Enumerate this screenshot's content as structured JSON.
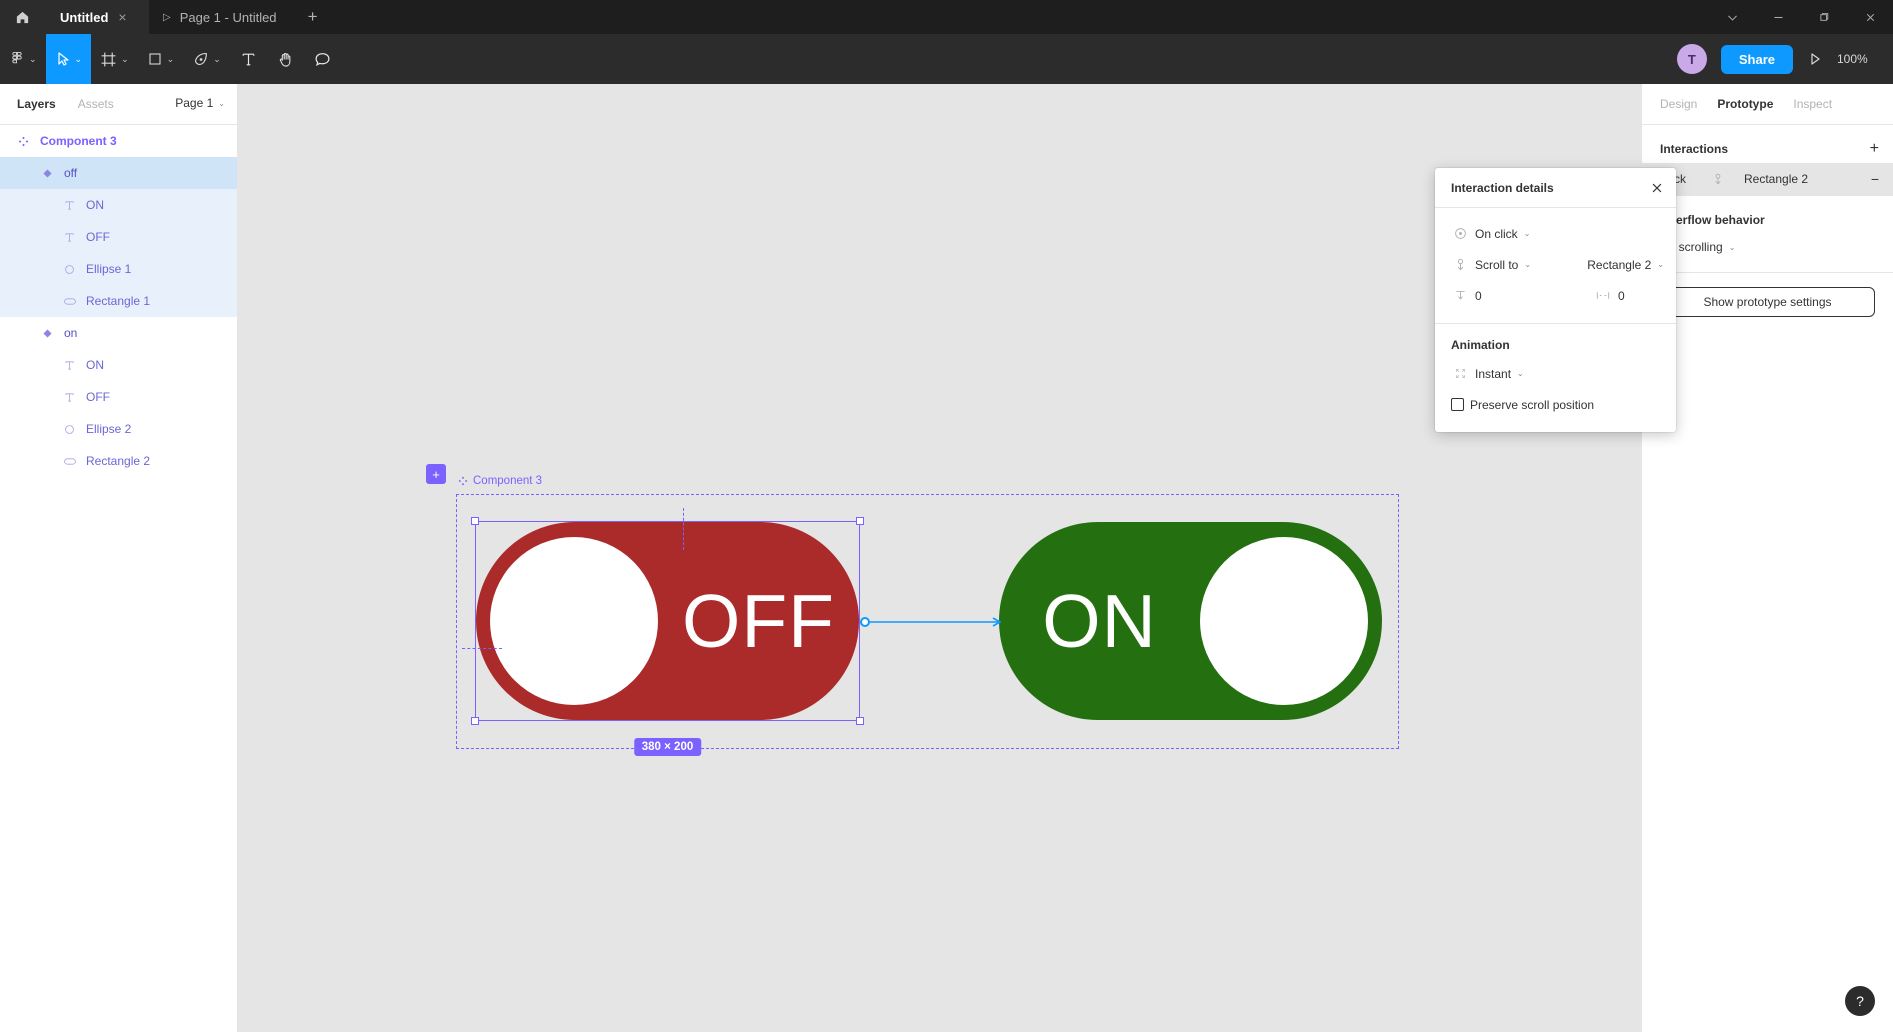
{
  "titlebar": {
    "home_icon": "home-icon",
    "file_tab": {
      "label": "Untitled",
      "close": "×"
    },
    "page_tab": {
      "play": "▷",
      "label": "Page 1 - Untitled"
    },
    "new_tab": "+",
    "window": {
      "chevron": "⌄",
      "minimize": "—",
      "maximize": "❐",
      "close": "✕"
    }
  },
  "toolbar": {
    "items": [
      {
        "name": "figma-menu-icon",
        "caret": "⌄"
      },
      {
        "name": "move-tool-icon",
        "caret": "⌄"
      },
      {
        "name": "frame-tool-icon",
        "caret": "⌄"
      },
      {
        "name": "shape-tool-icon",
        "caret": "⌄"
      },
      {
        "name": "pen-tool-icon",
        "caret": "⌄"
      },
      {
        "name": "text-tool-icon",
        "caret": ""
      },
      {
        "name": "hand-tool-icon",
        "caret": ""
      },
      {
        "name": "comment-tool-icon",
        "caret": ""
      }
    ],
    "avatar_initial": "T",
    "share_label": "Share",
    "present_icon": "▷",
    "zoom_level": "100%",
    "accent_color": "#0d99ff"
  },
  "left_panel": {
    "tabs": [
      {
        "label": "Layers",
        "active": true
      },
      {
        "label": "Assets",
        "active": false
      }
    ],
    "page_selector": {
      "label": "Page 1",
      "caret": "⌄"
    },
    "layers": [
      {
        "label": "Component 3",
        "icon": "component-icon",
        "level": "comp",
        "state": "none"
      },
      {
        "label": "off",
        "icon": "variant-icon",
        "level": "variant",
        "state": "sel-strong"
      },
      {
        "label": "ON",
        "icon": "text-icon",
        "level": "child",
        "state": "sel-light"
      },
      {
        "label": "OFF",
        "icon": "text-icon",
        "level": "child",
        "state": "sel-light"
      },
      {
        "label": "Ellipse 1",
        "icon": "ellipse-icon",
        "level": "child",
        "state": "sel-light"
      },
      {
        "label": "Rectangle 1",
        "icon": "rectangle-icon",
        "level": "child",
        "state": "sel-light"
      },
      {
        "label": "on",
        "icon": "variant-icon",
        "level": "variant",
        "state": "none"
      },
      {
        "label": "ON",
        "icon": "text-icon",
        "level": "child",
        "state": "none"
      },
      {
        "label": "OFF",
        "icon": "text-icon",
        "level": "child",
        "state": "none"
      },
      {
        "label": "Ellipse 2",
        "icon": "ellipse-icon",
        "level": "child",
        "state": "none"
      },
      {
        "label": "Rectangle 2",
        "icon": "rectangle-icon",
        "level": "child",
        "state": "none"
      }
    ]
  },
  "canvas": {
    "frame_label": "Component 3",
    "size_badge": "380 × 200",
    "plus_badge": "+",
    "toggle_off": {
      "label": "OFF",
      "color": "#ab2a2a",
      "knob_color": "#ffffff"
    },
    "toggle_on": {
      "label": "ON",
      "color": "#247010",
      "knob_color": "#ffffff"
    },
    "selection_color": "#7b61ff",
    "connector_color": "#0d99ff"
  },
  "popup": {
    "title": "Interaction details",
    "close_icon": "✕",
    "trigger": {
      "icon": "click-trigger-icon",
      "label": "On click",
      "caret": "⌄"
    },
    "action": {
      "icon": "scroll-to-icon",
      "label": "Scroll to",
      "caret": "⌄",
      "target": "Rectangle 2",
      "target_caret": "⌄"
    },
    "offsets": {
      "vertical_icon": "vertical-offset-icon",
      "vertical_value": "0",
      "horizontal_icon": "horizontal-offset-icon",
      "horizontal_value": "0"
    },
    "animation_section": "Animation",
    "animation": {
      "icon": "animation-icon",
      "label": "Instant",
      "caret": "⌄"
    },
    "preserve_scroll": "Preserve scroll position"
  },
  "right_panel": {
    "tabs": [
      {
        "label": "Design",
        "active": false
      },
      {
        "label": "Prototype",
        "active": true
      },
      {
        "label": "Inspect",
        "active": false
      }
    ],
    "interactions_title": "Interactions",
    "add_icon": "+",
    "interaction_row": {
      "trigger": "Click",
      "icon": "scroll-to-icon",
      "target": "Rectangle 2",
      "remove_icon": "−"
    },
    "overflow_title": "Overflow behavior",
    "overflow_value": "No scrolling",
    "overflow_caret": "⌄",
    "prototype_settings_label": "Show prototype settings"
  },
  "help": {
    "label": "?"
  }
}
